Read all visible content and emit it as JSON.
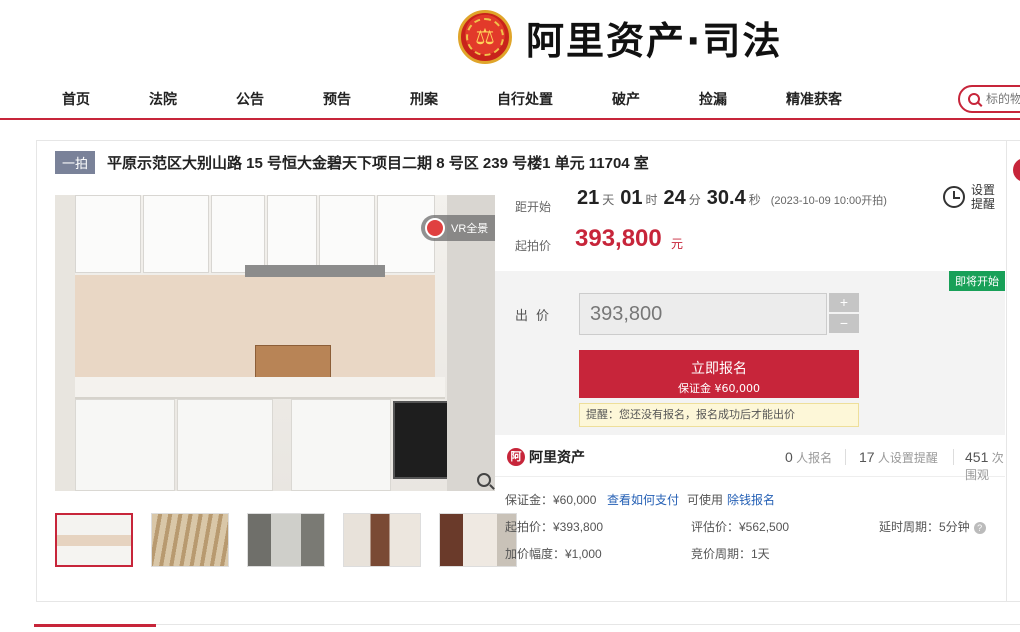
{
  "header": {
    "brand": "阿里资产·司法",
    "emblem_icon": "court-emblem-icon"
  },
  "nav": {
    "items": [
      "首页",
      "法院",
      "公告",
      "预告",
      "刑案",
      "自行处置",
      "破产",
      "捡漏",
      "精准获客"
    ],
    "search_placeholder": "标的物"
  },
  "item": {
    "tag": "一拍",
    "title": "平原示范区大别山路 15 号恒大金碧天下项目二期 8 号区 239 号楼1 单元 11704 室",
    "vr_label": "VR全景",
    "vr_arrow": "›"
  },
  "countdown": {
    "label": "距开始",
    "days": "21",
    "days_unit": "天",
    "hours": "01",
    "hours_unit": "时",
    "minutes": "24",
    "minutes_unit": "分",
    "seconds": "30.4",
    "seconds_unit": "秒",
    "start_note": "(2023-10-09 10:00开拍)"
  },
  "reminder": {
    "label": "设置提醒"
  },
  "starting_price": {
    "label": "起拍价",
    "value": "393,800",
    "unit": "元"
  },
  "bid": {
    "status_badge": "即将开始",
    "label": "出价",
    "input_value": "393,800",
    "plus": "+",
    "minus": "−",
    "apply_label": "立即报名",
    "deposit_line": "保证金 ¥60,000",
    "tip": "提醒：您还没有报名，报名成功后才能出价"
  },
  "stats": {
    "brand": "阿里资产",
    "brand_mark": "阿",
    "signups": "0",
    "signups_label": "人报名",
    "reminders": "17",
    "reminders_label": "人设置提醒",
    "views": "451",
    "views_label": "次围观"
  },
  "details": {
    "deposit": "保证金：¥60,000",
    "how_to_pay": "查看如何支付",
    "available": "可使用",
    "loan_signup": "除钱报名",
    "start_price": "起拍价：¥393,800",
    "eval_price": "评估价：¥562,500",
    "delay": "延时周期：5分钟",
    "increment": "加价幅度：¥1,000",
    "bid_cycle": "竞价周期：1天",
    "help": "?"
  },
  "colors": {
    "brand_red": "#c7253a",
    "badge_green": "#18a058",
    "link_blue": "#2560b5"
  }
}
